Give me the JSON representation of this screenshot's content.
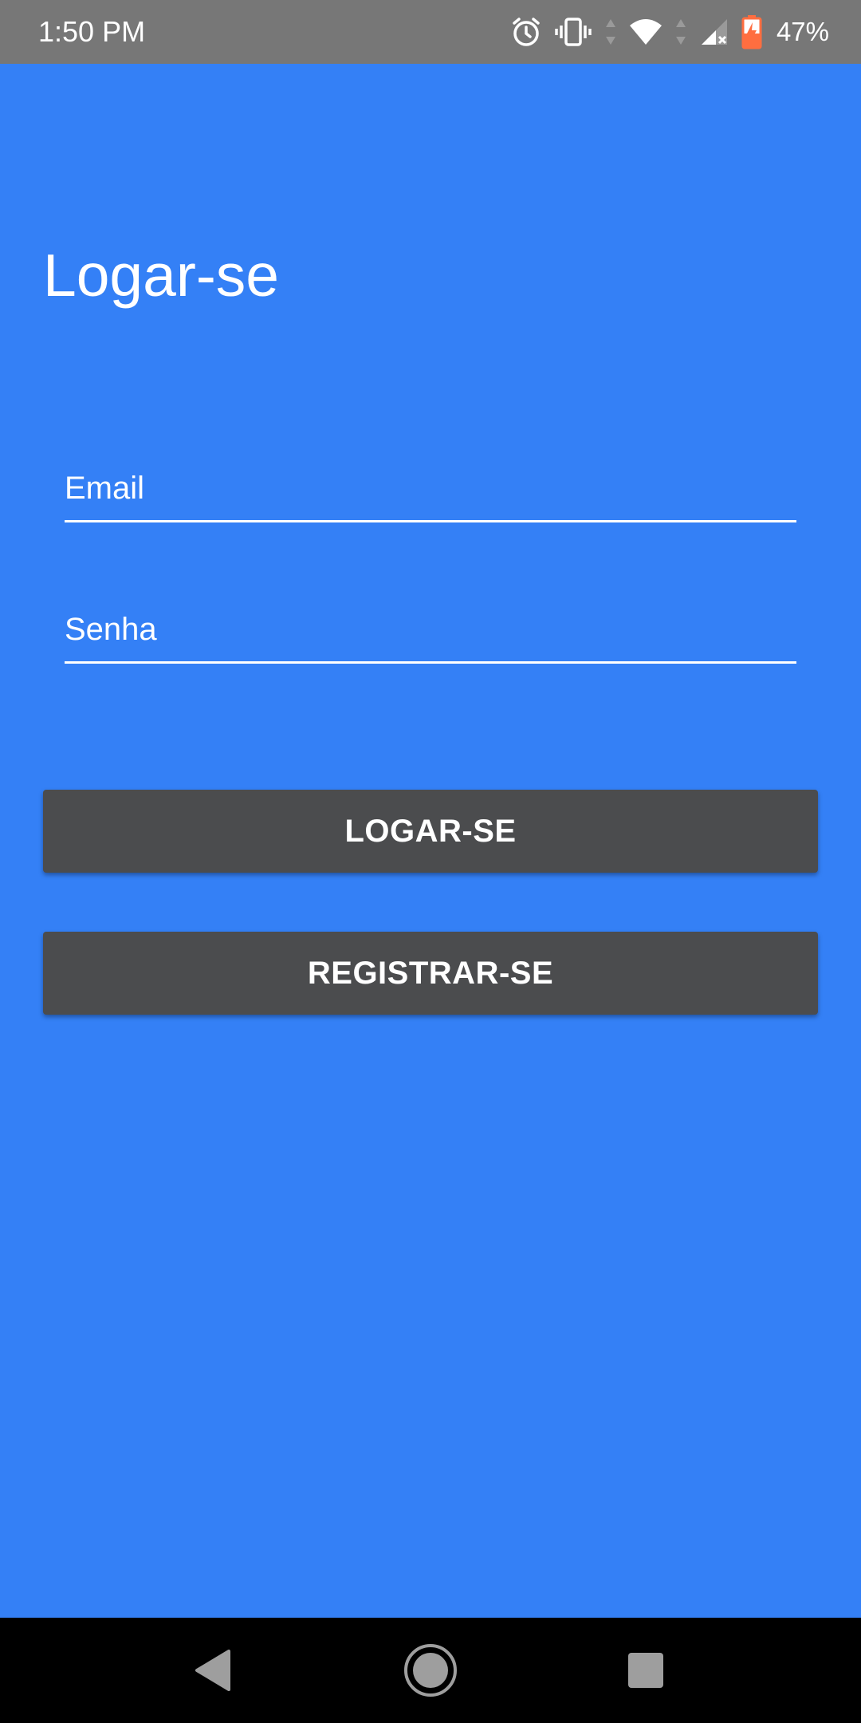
{
  "status_bar": {
    "time": "1:50 PM",
    "battery_percent": "47%",
    "icons": [
      "alarm-icon",
      "vibrate-icon",
      "data-arrows-icon",
      "wifi-icon",
      "cellular-no-signal-icon",
      "battery-charging-icon"
    ],
    "battery_color": "#FF6E40"
  },
  "page": {
    "title": "Logar-se",
    "background_color": "#3480F6"
  },
  "form": {
    "email_placeholder": "Email",
    "email_value": "",
    "password_placeholder": "Senha",
    "password_value": ""
  },
  "buttons": {
    "login_label": "LOGAR-SE",
    "register_label": "REGISTRAR-SE",
    "button_color": "#4B4C4E"
  },
  "nav_bar": {
    "icons": [
      "back-icon",
      "home-icon",
      "recents-icon"
    ]
  }
}
